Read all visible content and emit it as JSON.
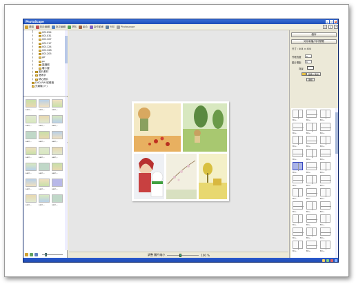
{
  "window": {
    "title": "PhotoScape"
  },
  "toolbar": {
    "items": [
      {
        "label": "看圖",
        "color": "#d0a030",
        "icon": "viewer-icon"
      },
      {
        "label": "相片編輯",
        "color": "#c05050",
        "icon": "editor-icon"
      },
      {
        "label": "批次編輯",
        "color": "#5080c0",
        "icon": "batch-icon"
      },
      {
        "label": "拼貼",
        "color": "#50a050",
        "icon": "page-icon"
      },
      {
        "label": "組合",
        "color": "#a06040",
        "icon": "combine-icon"
      },
      {
        "label": "製作動畫",
        "color": "#8060c0",
        "icon": "gif-icon"
      },
      {
        "label": "列印",
        "color": "#6080a0",
        "icon": "print-icon"
      },
      {
        "label": "Photoscape",
        "color": "#a0a0a0",
        "icon": "photoscape-icon"
      }
    ]
  },
  "tree": {
    "items": [
      {
        "label": "001024",
        "indent": 1
      },
      {
        "label": "001031",
        "indent": 1
      },
      {
        "label": "001107",
        "indent": 1
      },
      {
        "label": "001117",
        "indent": 1
      },
      {
        "label": "001124",
        "indent": 1
      },
      {
        "label": "001128",
        "indent": 1
      },
      {
        "label": "001205",
        "indent": 1
      },
      {
        "label": "gif",
        "indent": 1
      },
      {
        "label": "pc",
        "indent": 1
      },
      {
        "label": "婚攝照",
        "indent": 1
      },
      {
        "label": "暖小屋",
        "indent": 1
      },
      {
        "label": "圖片素材",
        "indent": 0
      },
      {
        "label": "藝術字",
        "indent": 0
      },
      {
        "label": "精心照片",
        "indent": 0
      },
      {
        "label": "DVD-RW 磁碟機",
        "indent": -1
      },
      {
        "label": "光碟機 (F:)",
        "indent": -1
      }
    ]
  },
  "thumbnails": {
    "labels": [
      "sen\\...",
      "sen\\...",
      "sen\\...",
      "sen\\...",
      "sen\\...",
      "sen\\...",
      "sen\\...",
      "sen\\...",
      "sen\\...",
      "sen\\...",
      "sen\\...",
      "sen\\...",
      "sen\\...",
      "sen\\...",
      "sen\\...",
      "sen\\...",
      "sen\\...",
      "sen\\...",
      "sen\\...",
      "sen\\...",
      "sen\\..."
    ]
  },
  "center": {
    "zoom_label": "調整 圖片縮小",
    "zoom_value": "100 %"
  },
  "right": {
    "save_label": "儲存",
    "secondary_label": "另存新檔/列印預覽",
    "size_label": "尺寸 : 404 × 404",
    "margin_outer_label": "外框寬度",
    "margin_outer_value": "6",
    "margin_inner_label": "圖片間距",
    "margin_inner_value": "6",
    "bg_label": "背景",
    "round_label": "圓角 / 裁剪",
    "apply_label": "邊框"
  },
  "layouts": {
    "labels": [
      "Bin...",
      "Bin...",
      "Bin...",
      "Bin...",
      "Bin...",
      "Bin...",
      "Bin...",
      "Bin...",
      "Bin...",
      "Bin...",
      "Bin...",
      "Bin...",
      "Bin...",
      "Bin...",
      "Bin...",
      "Bin...",
      "Bin...",
      "Bin...",
      "Bin...",
      "Bin...",
      "Bin...",
      "Bin...",
      "Bin...",
      "Bin...",
      "Bin...",
      "Bin...",
      "Bin...",
      "Bin...",
      "Bin...",
      "Bin...",
      "Bin...",
      "Bin...",
      "Bin..."
    ]
  }
}
